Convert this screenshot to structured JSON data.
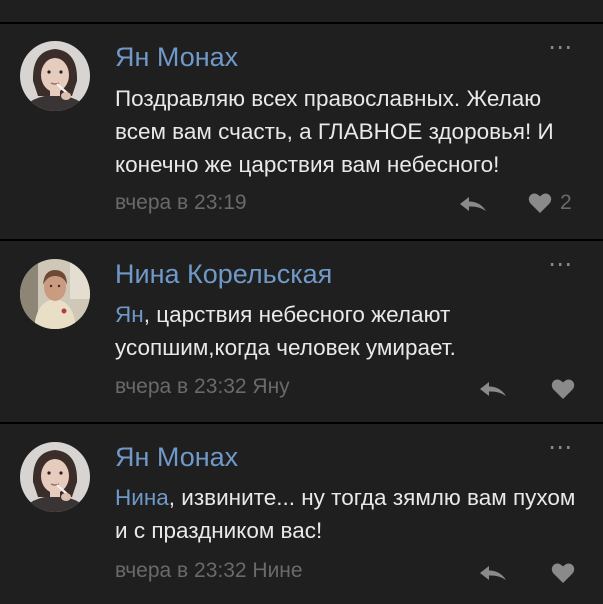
{
  "comments": [
    {
      "author": "Ян Монах",
      "mention": "",
      "text": "Поздравляю всех православных. Желаю всем вам счасть, а ГЛАВНОЕ здоровья! И конечно же царствия вам небесного!",
      "timestamp": "вчера в 23:19",
      "likes": "2",
      "more_icon": "⋯"
    },
    {
      "author": "Нина Корельская",
      "mention": "Ян",
      "text": ", царствия небесного желают усопшим,когда человек умирает.",
      "timestamp": "вчера в 23:32 Яну",
      "likes": "",
      "more_icon": "⋯"
    },
    {
      "author": "Ян Монах",
      "mention": "Нина",
      "text": ", извините... ну тогда зямлю вам пухом и с праздником вас!",
      "timestamp": "вчера в 23:32 Нине",
      "likes": "",
      "more_icon": "⋯"
    }
  ],
  "colors": {
    "background": "#000000",
    "card": "#1f1f1f",
    "link": "#6f99c8",
    "text": "#e9e9e9",
    "muted": "#6a6a6a",
    "icon": "#8a8a8a"
  },
  "icons": {
    "reply": "reply-arrow-icon",
    "like": "heart-icon",
    "more": "more-dots-icon"
  }
}
